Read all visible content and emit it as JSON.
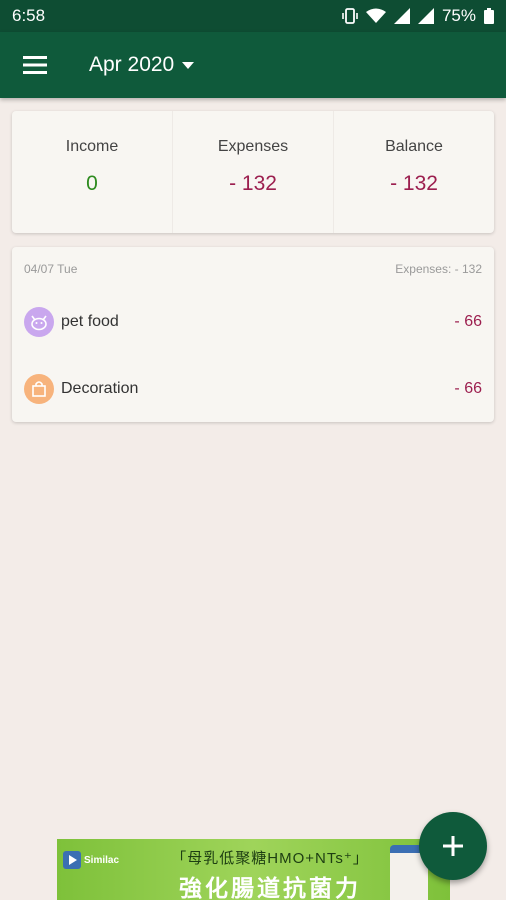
{
  "status_bar": {
    "time": "6:58",
    "battery": "75%"
  },
  "app_bar": {
    "month": "Apr 2020"
  },
  "summary": {
    "income_label": "Income",
    "income_value": "0",
    "expenses_label": "Expenses",
    "expenses_value": "- 132",
    "balance_label": "Balance",
    "balance_value": "- 132"
  },
  "day": {
    "date": "04/07 Tue",
    "total": "Expenses: - 132",
    "transactions": [
      {
        "name": "pet food",
        "amount": "- 66",
        "icon": "pet-icon",
        "color": "#c9a7ee"
      },
      {
        "name": "Decoration",
        "amount": "- 66",
        "icon": "shopping-bag-icon",
        "color": "#f7b37c"
      }
    ]
  },
  "ad": {
    "brand": "Similac",
    "line1": "「母乳低聚糖HMO+NTs⁺」",
    "line2": "強化腸道抗菌力"
  },
  "colors": {
    "primary": "#0f5a3b",
    "status": "#0e4d33",
    "income": "#2e8b1f",
    "expense": "#9c1f4f",
    "background": "#f3ece8"
  }
}
